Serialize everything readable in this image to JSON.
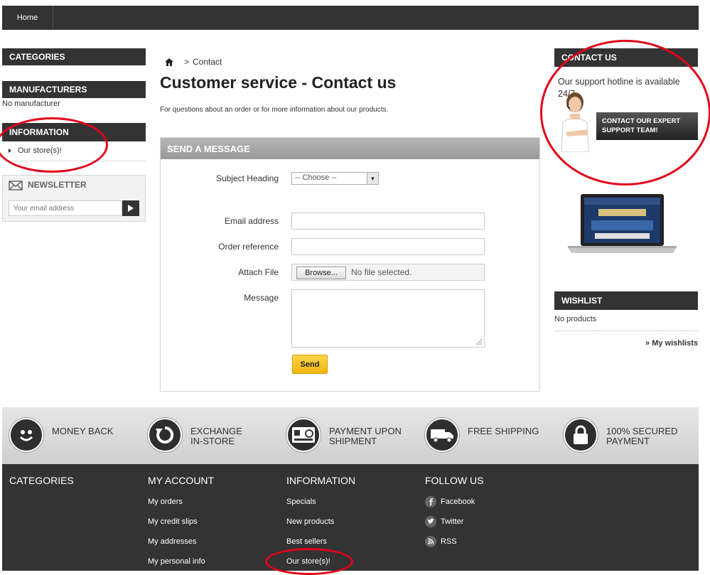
{
  "nav": {
    "home": "Home"
  },
  "left": {
    "categories_title": "CATEGORIES",
    "manufacturers_title": "MANUFACTURERS",
    "no_manufacturer": "No manufacturer",
    "information_title": "INFORMATION",
    "information_items": [
      "Our store(s)!"
    ],
    "newsletter_title": "NEWSLETTER",
    "newsletter_placeholder": "Your email address"
  },
  "breadcrumb": {
    "current": "Contact",
    "separator": ">"
  },
  "page": {
    "title": "Customer service - Contact us",
    "description": "For questions about an order or for more information about our products."
  },
  "form": {
    "header": "SEND A MESSAGE",
    "subject_label": "Subject Heading",
    "subject_value": "-- Choose --",
    "email_label": "Email address",
    "order_label": "Order reference",
    "attach_label": "Attach File",
    "browse_label": "Browse...",
    "no_file": "No file selected.",
    "message_label": "Message",
    "send_label": "Send"
  },
  "right": {
    "contact_title": "CONTACT US",
    "hotline": "Our support hotline is available 24/7.",
    "support_button": "CONTACT OUR EXPERT SUPPORT TEAM!",
    "wishlist_title": "WISHLIST",
    "no_products": "No products",
    "my_wishlists": "» My wishlists"
  },
  "features": [
    {
      "icon": "smiley-icon",
      "line1": "MONEY BACK",
      "line2": ""
    },
    {
      "icon": "refresh-icon",
      "line1": "EXCHANGE",
      "line2": "IN-STORE"
    },
    {
      "icon": "card-icon",
      "line1": "PAYMENT UPON",
      "line2": "SHIPMENT"
    },
    {
      "icon": "truck-icon",
      "line1": "FREE SHIPPING",
      "line2": ""
    },
    {
      "icon": "lock-icon",
      "line1": "100% SECURED",
      "line2": "PAYMENT"
    }
  ],
  "footer": {
    "categories_title": "CATEGORIES",
    "account_title": "MY ACCOUNT",
    "account_links": [
      "My orders",
      "My credit slips",
      "My addresses",
      "My personal info"
    ],
    "information_title": "INFORMATION",
    "information_links": [
      "Specials",
      "New products",
      "Best sellers",
      "Our store(s)!"
    ],
    "follow_title": "FOLLOW US",
    "follow_links": [
      "Facebook",
      "Twitter",
      "RSS"
    ]
  },
  "colors": {
    "dark": "#333333",
    "accent": "#f2b60e",
    "annotation": "#e2001a"
  }
}
